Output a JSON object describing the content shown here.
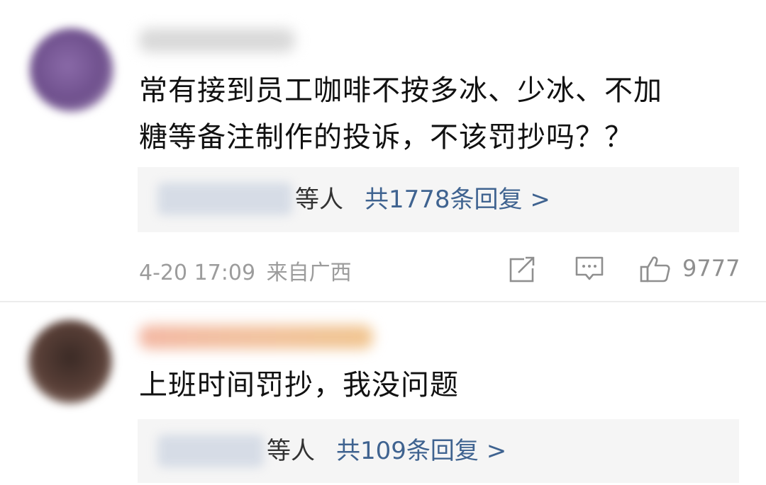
{
  "comments": [
    {
      "text_line1": "常有接到员工咖啡不按多冰、少冰、不加",
      "text_line2": "糖等备注制作的投诉，不该罚抄吗？？",
      "reply_suffix": "等人",
      "reply_link": "共1778条回复 >",
      "timestamp": "4-20 17:09",
      "location": "来自广西",
      "like_count": "9777"
    },
    {
      "text_line1": "上班时间罚抄，我没问题",
      "reply_suffix": "等人",
      "reply_link": "共109条回复 >"
    }
  ],
  "icons": {
    "share": "share-icon",
    "comment": "comment-icon",
    "like": "like-icon"
  },
  "colors": {
    "link": "#3f6390",
    "meta": "#9c9c9c",
    "reply_bg": "#f5f5f5"
  }
}
